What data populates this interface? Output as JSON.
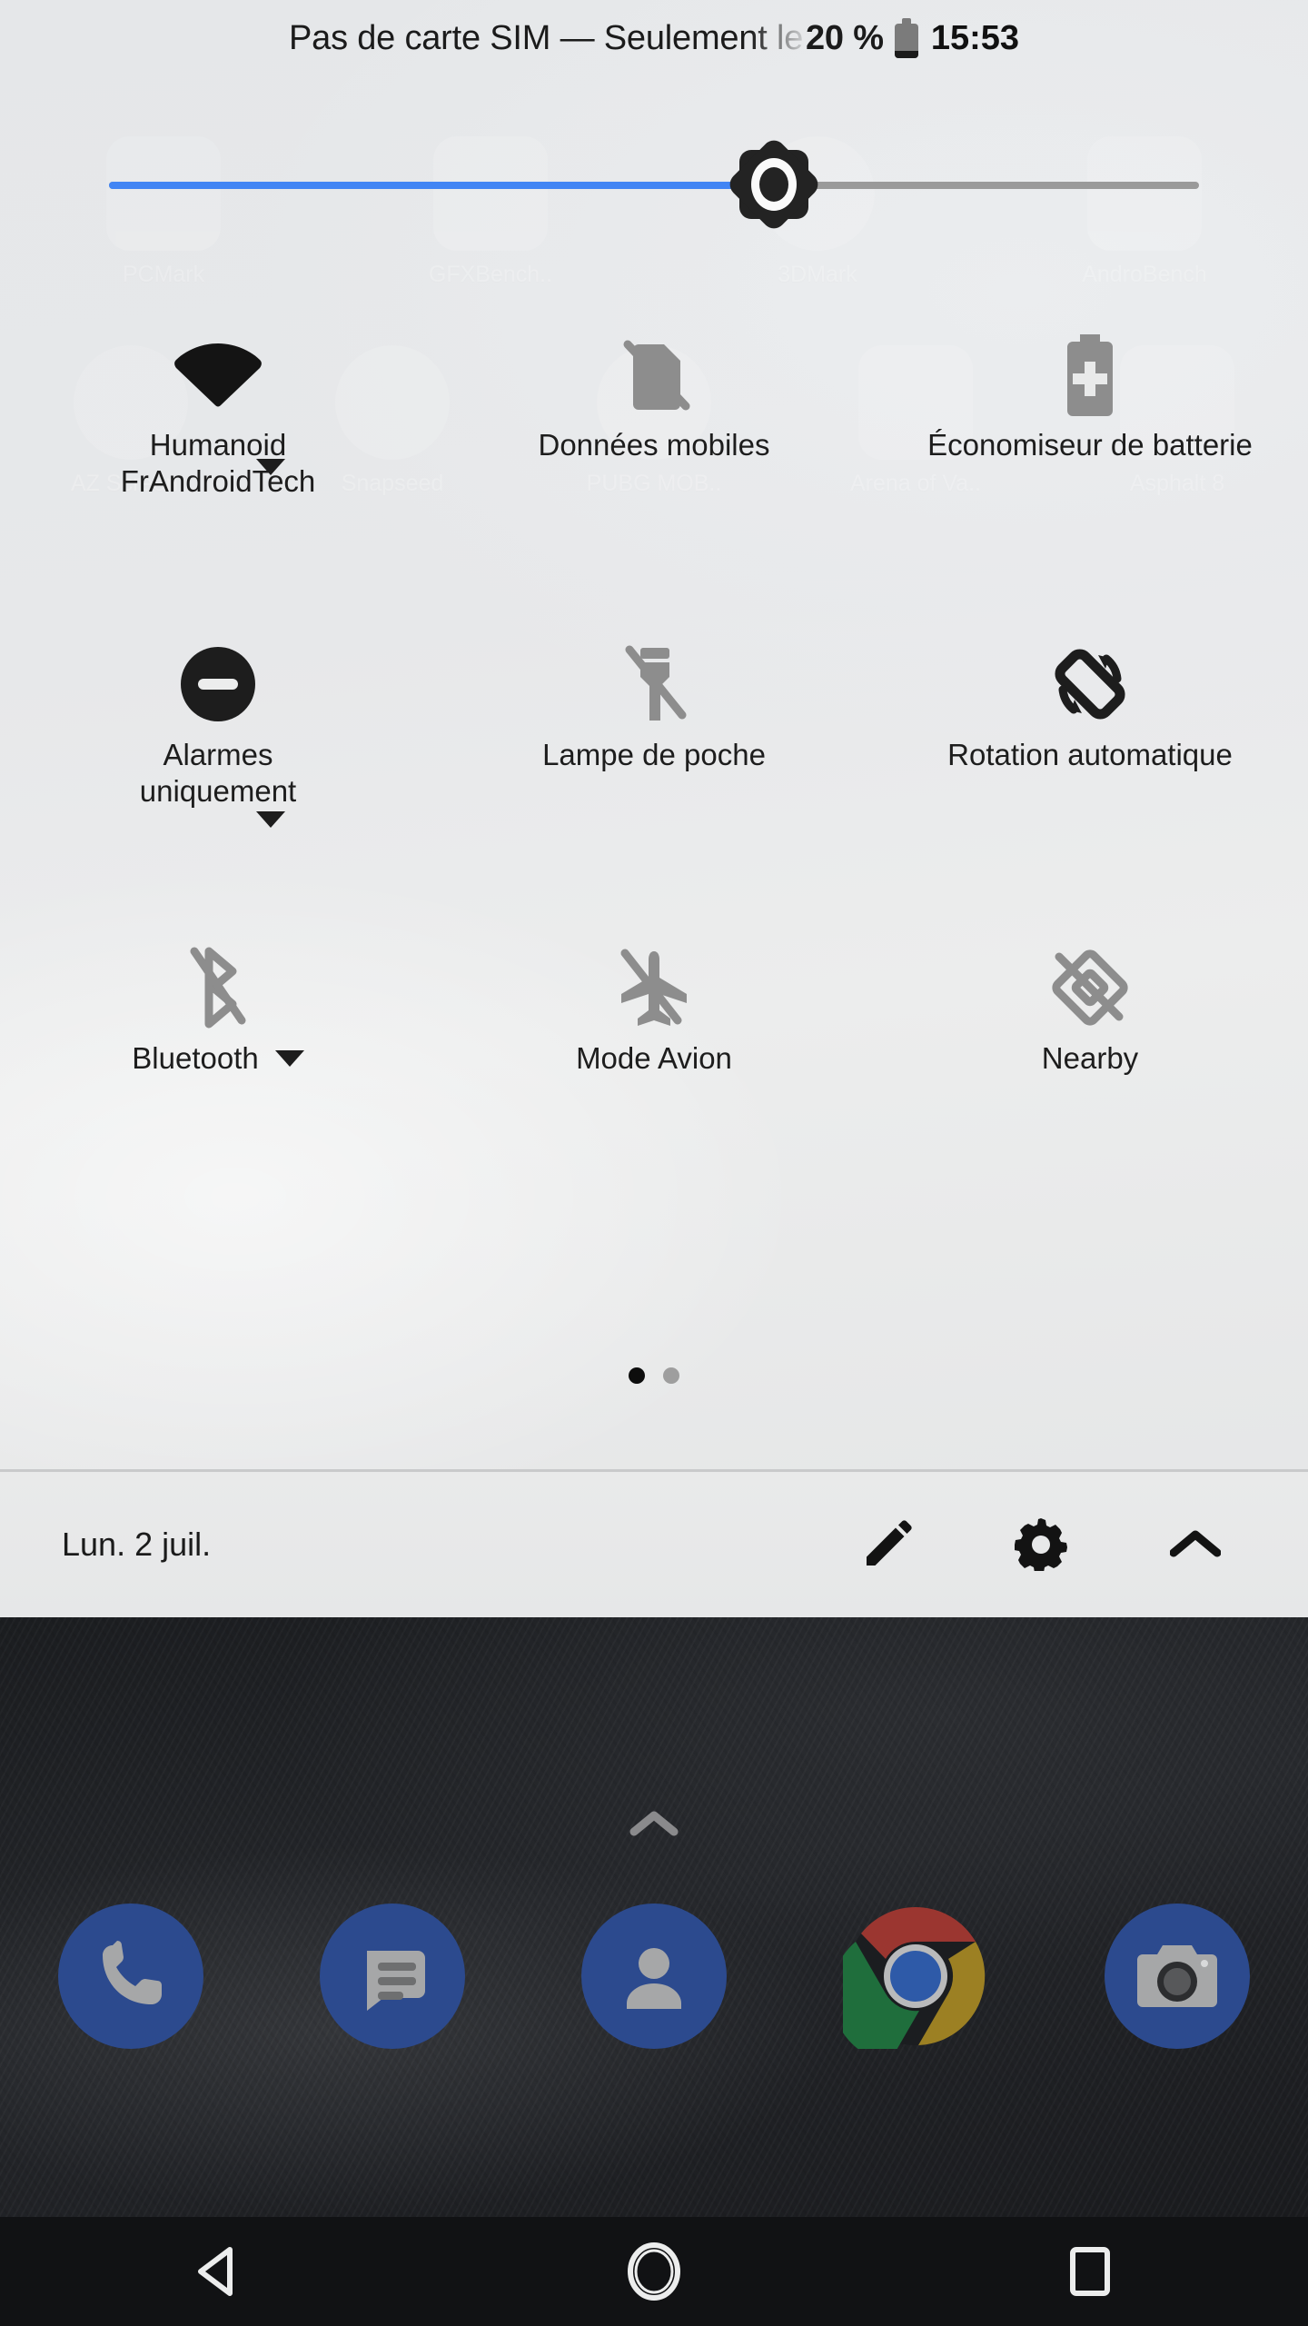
{
  "status_bar": {
    "carrier_text": "Pas de carte SIM — Seulement le",
    "battery_percent": "20 %",
    "battery_icon": "battery-low-icon",
    "clock": "15:53"
  },
  "brightness": {
    "name": "brightness-slider",
    "value_percent": 61,
    "thumb_icon": "brightness-sun-icon",
    "fill_color": "#4285f4",
    "track_color": "#9a9a9a"
  },
  "tiles": [
    {
      "label": "Humanoid\nFrAndroidTech",
      "line1": "Humanoid",
      "line2": "FrAndroidTech",
      "icon": "wifi-icon",
      "state": "on",
      "has_dropdown": true,
      "dropdown_position": "right"
    },
    {
      "label": "Données mobiles",
      "icon": "mobile-data-off-icon",
      "state": "off",
      "has_dropdown": false
    },
    {
      "label": "Économiseur de batterie",
      "icon": "battery-saver-icon",
      "state": "off",
      "has_dropdown": false
    },
    {
      "label": "Alarmes uniquement",
      "line1": "Alarmes",
      "line2": "uniquement",
      "icon": "do-not-disturb-icon",
      "state": "on",
      "has_dropdown": true,
      "dropdown_position": "right"
    },
    {
      "label": "Lampe de poche",
      "icon": "flashlight-off-icon",
      "state": "off",
      "has_dropdown": false
    },
    {
      "label": "Rotation automatique",
      "icon": "auto-rotate-icon",
      "state": "on",
      "has_dropdown": false
    },
    {
      "label": "Bluetooth",
      "icon": "bluetooth-off-icon",
      "state": "off",
      "has_dropdown": true,
      "dropdown_position": "inline"
    },
    {
      "label": "Mode Avion",
      "icon": "airplane-off-icon",
      "state": "off",
      "has_dropdown": false
    },
    {
      "label": "Nearby",
      "icon": "nearby-off-icon",
      "state": "off",
      "has_dropdown": false
    }
  ],
  "pager": {
    "pages": 2,
    "active_index": 0
  },
  "footer": {
    "date": "Lun. 2 juil.",
    "edit_icon": "pencil-icon",
    "settings_icon": "gear-icon",
    "collapse_icon": "chevron-up-icon"
  },
  "home_screen": {
    "drawer_icon": "chevron-up-icon",
    "ghost_apps": [
      [
        "PCMark",
        "GFXBench..",
        "3DMark",
        "AndroBench"
      ],
      [
        "AZ Screen..",
        "Snapseed",
        "PUBG MOB..",
        "Arena of Va..",
        "Asphalt 8"
      ]
    ],
    "dock": [
      {
        "name": "Téléphone",
        "icon": "phone-icon"
      },
      {
        "name": "Messages",
        "icon": "messages-icon"
      },
      {
        "name": "Contacts",
        "icon": "contacts-icon"
      },
      {
        "name": "Chrome",
        "icon": "chrome-icon"
      },
      {
        "name": "Appareil photo",
        "icon": "camera-icon"
      }
    ]
  },
  "nav_bar": {
    "back": "back-icon",
    "home": "home-icon",
    "recents": "recents-icon"
  },
  "colors": {
    "accent_blue": "#4285f4",
    "panel_bg": "#e8e9ea",
    "tile_on": "#1d1d1d",
    "tile_off": "#8d8d8d",
    "dock_blue": "#2c4a8e"
  }
}
